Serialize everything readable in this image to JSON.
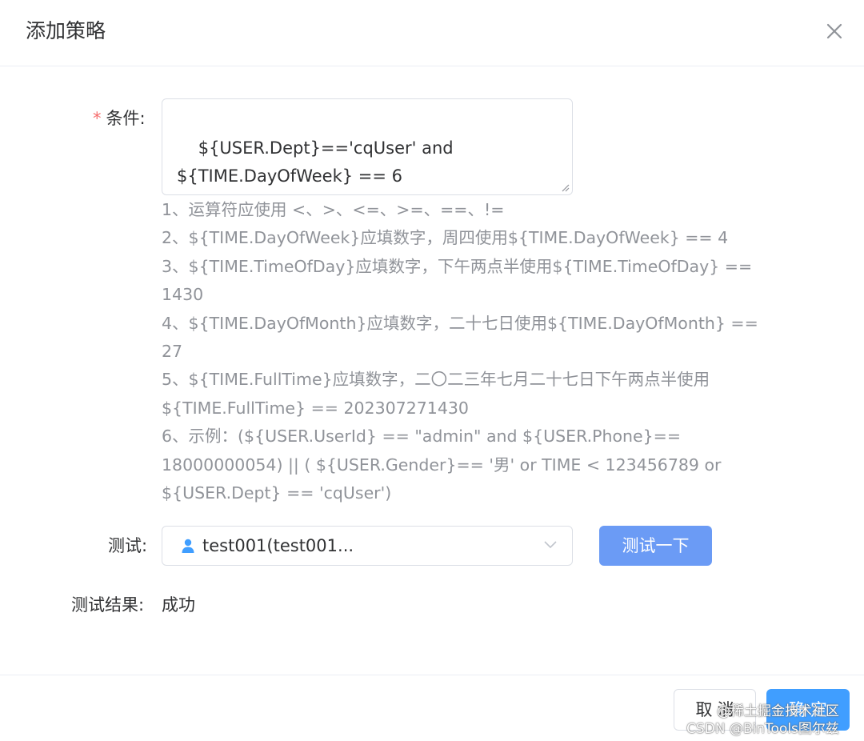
{
  "dialog": {
    "title": "添加策略"
  },
  "form": {
    "condition_label": "条件:",
    "required_mark": "*",
    "condition_value": "${USER.Dept}=='cqUser' and\n${TIME.DayOfWeek} == 6",
    "hints": [
      "1、运算符应使用 <、>、<=、>=、==、!=",
      "2、${TIME.DayOfWeek}应填数字，周四使用${TIME.DayOfWeek} == 4",
      "3、${TIME.TimeOfDay}应填数字，下午两点半使用${TIME.TimeOfDay} == 1430",
      "4、${TIME.DayOfMonth}应填数字，二十七日使用${TIME.DayOfMonth} == 27",
      "5、${TIME.FullTime}应填数字，二〇二三年七月二十七日下午两点半使用${TIME.FullTime} == 202307271430",
      "6、示例：(${USER.UserId} == \"admin\" and ${USER.Phone}== 18000000054) || ( ${USER.Gender}== '男' or TIME < 123456789 or ${USER.Dept} == 'cqUser')"
    ],
    "test_label": "测试:",
    "test_user_value": "test001(test001...",
    "test_button": "测试一下",
    "result_label": "测试结果:",
    "result_value": "成功"
  },
  "footer": {
    "cancel": "取消",
    "ok": "确定"
  },
  "watermark": {
    "line1": "@稀土掘金技术社区",
    "line2": "CSDN @BinTools图尔兹"
  },
  "icons": {
    "close": "close-icon",
    "user": "user-icon",
    "chevron": "chevron-down-icon",
    "resize": "resize-handle-icon"
  },
  "colors": {
    "primary": "#409eff",
    "test_button": "#6b9bf5",
    "required": "#f56c6c",
    "hint_text": "#909399"
  }
}
